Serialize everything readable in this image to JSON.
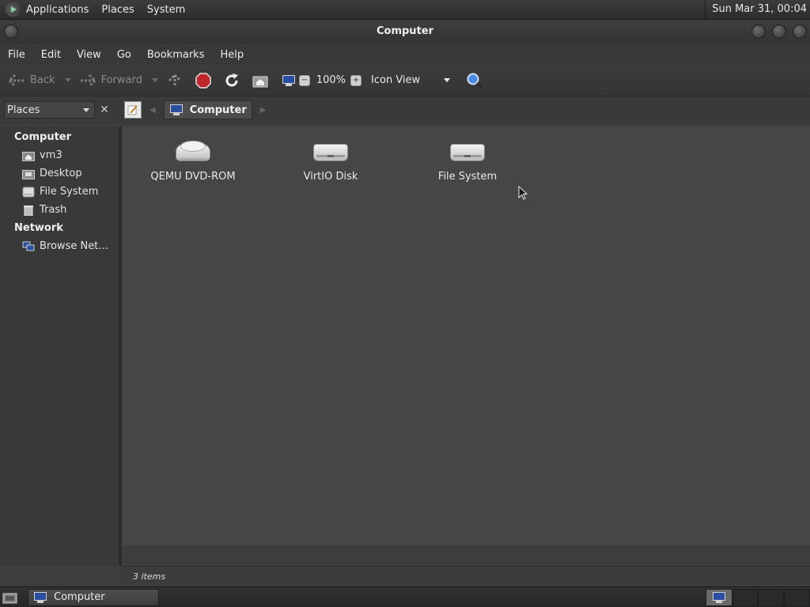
{
  "top_panel": {
    "menus": [
      "Applications",
      "Places",
      "System"
    ],
    "clock": "Sun Mar 31, 00:04"
  },
  "window": {
    "title": "Computer",
    "menubar": [
      "File",
      "Edit",
      "View",
      "Go",
      "Bookmarks",
      "Help"
    ],
    "toolbar": {
      "back_label": "Back",
      "forward_label": "Forward",
      "zoom_level": "100%",
      "view_mode": "Icon View"
    },
    "location": {
      "places_selector": "Places",
      "breadcrumb": "Computer"
    },
    "sidebar": {
      "sections": [
        {
          "heading": "Computer",
          "items": [
            "vm3",
            "Desktop",
            "File System",
            "Trash"
          ]
        },
        {
          "heading": "Network",
          "items": [
            "Browse Net…"
          ]
        }
      ]
    },
    "files": [
      {
        "name": "QEMU DVD-ROM",
        "icon": "dvd-drive-icon"
      },
      {
        "name": "VirtIO Disk",
        "icon": "hard-disk-icon"
      },
      {
        "name": "File System",
        "icon": "hard-disk-icon"
      }
    ],
    "status": "3 items"
  },
  "taskbar": {
    "tasks": [
      "Computer"
    ]
  },
  "colors": {
    "background": "#3a3a3a",
    "content": "#464646",
    "text": "#e6e6e6",
    "stop_red": "#c0272d",
    "search_blue": "#3a7bd5"
  }
}
